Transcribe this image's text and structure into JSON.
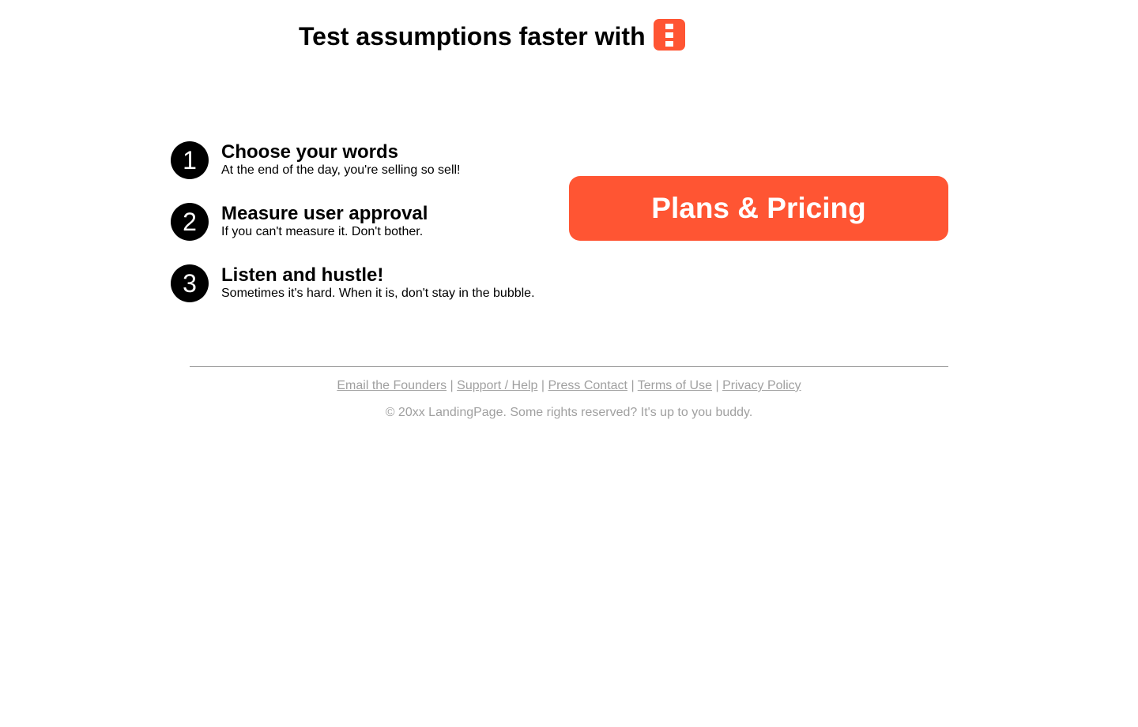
{
  "header": {
    "title": "Test assumptions faster with",
    "logo_icon": "orange-ladder-logo-icon",
    "logo_color": "#ff5533"
  },
  "steps": [
    {
      "number": "1",
      "title": "Choose your words",
      "description": "At the end of the day, you're selling so sell!"
    },
    {
      "number": "2",
      "title": "Measure user approval",
      "description": "If you can't measure it. Don't bother."
    },
    {
      "number": "3",
      "title": "Listen and hustle!",
      "description": "Sometimes it's hard. When it is, don't stay in the bubble."
    }
  ],
  "cta": {
    "label": "Plans & Pricing",
    "color": "#ff5533"
  },
  "footer": {
    "links": [
      "Email the Founders",
      "Support / Help",
      "Press Contact",
      "Terms of Use",
      "Privacy Policy"
    ],
    "separator": "|",
    "copyright": "© 20xx LandingPage. Some rights reserved? It's up to you buddy."
  }
}
